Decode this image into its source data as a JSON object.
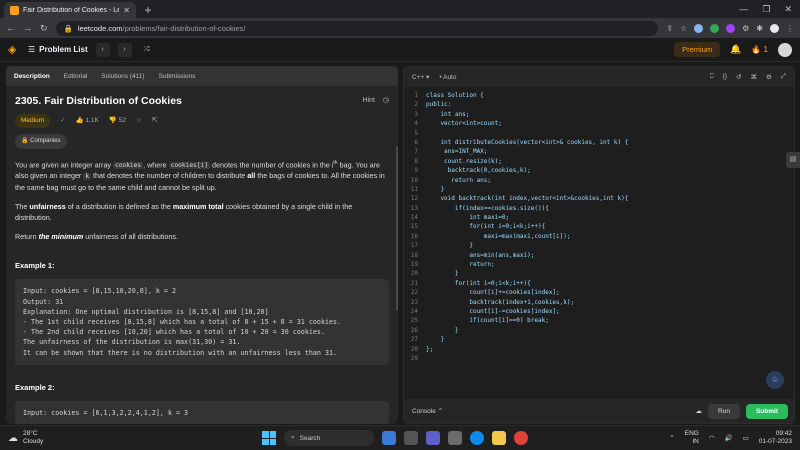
{
  "browser": {
    "tab_title": "Fair Distribution of Cookies - Lee",
    "url_host": "leetcode.com",
    "url_path": "/problems/fair-distribution-of-cookies/"
  },
  "nav": {
    "problem_list": "Problem List",
    "premium": "Premium",
    "streak": "1"
  },
  "left": {
    "tabs": [
      "Description",
      "Editorial",
      "Solutions (411)",
      "Submissions"
    ],
    "title": "2305. Fair Distribution of Cookies",
    "hint": "Hint",
    "difficulty": "Medium",
    "likes": "1.1K",
    "dislikes": "52",
    "companies": "Companies",
    "para1_a": "You are given an integer array ",
    "para1_code1": "cookies",
    "para1_b": ", where ",
    "para1_code2": "cookies[i]",
    "para1_c": " denotes the number of cookies in the i",
    "para1_sup": "th",
    "para1_d": " bag. You are also given an integer ",
    "para1_code3": "k",
    "para1_e": " that denotes the number of children to distribute ",
    "para1_bold": "all",
    "para1_f": " the bags of cookies to. All the cookies in the same bag must go to the same child and cannot be split up.",
    "para2_bold1": "unfairness",
    "para2_a": "The ",
    "para2_b": " of a distribution is defined as the ",
    "para2_bold2": "maximum total",
    "para2_c": " cookies obtained by a single child in the distribution.",
    "para3_a": "Return ",
    "para3_bi": "the minimum",
    "para3_b": " unfairness of all distributions.",
    "example1_title": "Example 1:",
    "example1_text": "Input: cookies = [8,15,10,20,8], k = 2\nOutput: 31\nExplanation: One optimal distribution is [8,15,8] and [10,20]\n- The 1st child receives [8,15,8] which has a total of 8 + 15 + 8 = 31 cookies.\n- The 2nd child receives [10,20] which has a total of 10 + 20 = 30 cookies.\nThe unfairness of the distribution is max(31,30) = 31.\nIt can be shown that there is no distribution with an unfairness less than 31.",
    "example2_title": "Example 2:",
    "example2_text": "Input: cookies = [6,1,3,2,2,4,1,2], k = 3"
  },
  "right": {
    "language": "C++",
    "auto": "Auto",
    "console": "Console",
    "run": "Run",
    "submit": "Submit",
    "code_lines": [
      "class Solution {",
      "public:",
      "    int ans;",
      "    vector<int>count;",
      "",
      "    int distributeCookies(vector<int>& cookies, int k) {",
      "     ans=INT_MAX;",
      "     count.resize(k);",
      "      backtrack(0,cookies,k);",
      "       return ans;",
      "    }",
      "    void backtrack(int index,vector<int>&cookies,int k){",
      "        if(index==cookies.size()){",
      "            int maxi=0;",
      "            for(int i=0;i<k;i++){",
      "                maxi=max(maxi,count[i]);",
      "            }",
      "            ans=min(ans,maxi);",
      "            return;",
      "        }",
      "        for(int i=0;i<k;i++){",
      "            count[i]+=cookies[index];",
      "            backtrack(index+1,cookies,k);",
      "            count[i]-=cookies[index];",
      "            if(count[i]==0) break;",
      "        }",
      "    }",
      "};",
      ""
    ]
  },
  "taskbar": {
    "temp": "28°C",
    "weather": "Cloudy",
    "search": "Search",
    "lang1": "ENG",
    "lang2": "IN",
    "time": "09:42",
    "date": "01-07-2023"
  }
}
